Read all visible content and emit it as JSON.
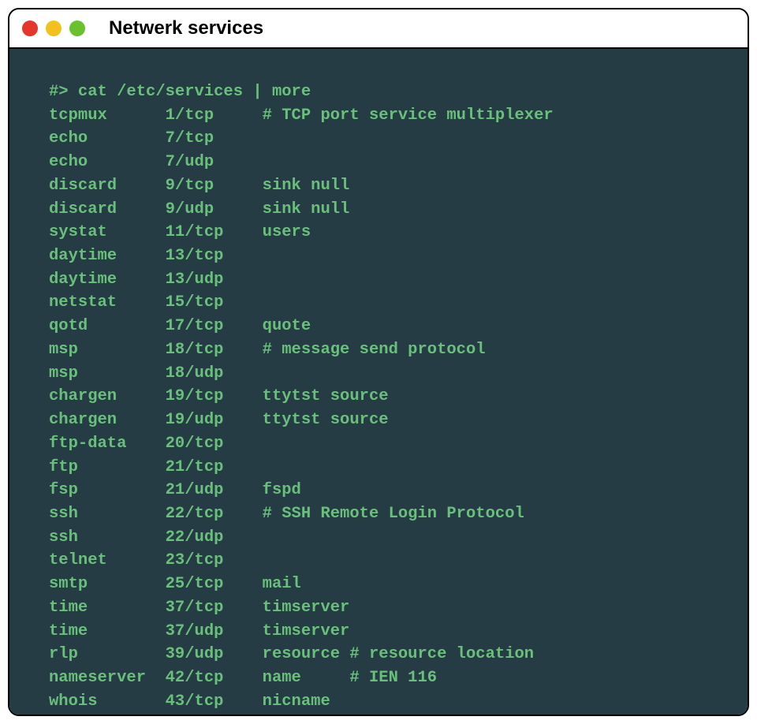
{
  "window": {
    "title": "Netwerk services"
  },
  "terminal": {
    "prompt": "#> cat /etc/services | more",
    "rows": [
      {
        "name": "tcpmux",
        "port": "1/tcp",
        "alias": "",
        "comment": "# TCP port service multiplexer"
      },
      {
        "name": "echo",
        "port": "7/tcp",
        "alias": "",
        "comment": ""
      },
      {
        "name": "echo",
        "port": "7/udp",
        "alias": "",
        "comment": ""
      },
      {
        "name": "discard",
        "port": "9/tcp",
        "alias": "sink null",
        "comment": ""
      },
      {
        "name": "discard",
        "port": "9/udp",
        "alias": "sink null",
        "comment": ""
      },
      {
        "name": "systat",
        "port": "11/tcp",
        "alias": "users",
        "comment": ""
      },
      {
        "name": "daytime",
        "port": "13/tcp",
        "alias": "",
        "comment": ""
      },
      {
        "name": "daytime",
        "port": "13/udp",
        "alias": "",
        "comment": ""
      },
      {
        "name": "netstat",
        "port": "15/tcp",
        "alias": "",
        "comment": ""
      },
      {
        "name": "qotd",
        "port": "17/tcp",
        "alias": "quote",
        "comment": ""
      },
      {
        "name": "msp",
        "port": "18/tcp",
        "alias": "",
        "comment": "# message send protocol"
      },
      {
        "name": "msp",
        "port": "18/udp",
        "alias": "",
        "comment": ""
      },
      {
        "name": "chargen",
        "port": "19/tcp",
        "alias": "ttytst source",
        "comment": ""
      },
      {
        "name": "chargen",
        "port": "19/udp",
        "alias": "ttytst source",
        "comment": ""
      },
      {
        "name": "ftp-data",
        "port": "20/tcp",
        "alias": "",
        "comment": ""
      },
      {
        "name": "ftp",
        "port": "21/tcp",
        "alias": "",
        "comment": ""
      },
      {
        "name": "fsp",
        "port": "21/udp",
        "alias": "fspd",
        "comment": ""
      },
      {
        "name": "ssh",
        "port": "22/tcp",
        "alias": "",
        "comment": "# SSH Remote Login Protocol"
      },
      {
        "name": "ssh",
        "port": "22/udp",
        "alias": "",
        "comment": ""
      },
      {
        "name": "telnet",
        "port": "23/tcp",
        "alias": "",
        "comment": ""
      },
      {
        "name": "smtp",
        "port": "25/tcp",
        "alias": "mail",
        "comment": ""
      },
      {
        "name": "time",
        "port": "37/tcp",
        "alias": "timserver",
        "comment": ""
      },
      {
        "name": "time",
        "port": "37/udp",
        "alias": "timserver",
        "comment": ""
      },
      {
        "name": "rlp",
        "port": "39/udp",
        "alias": "resource",
        "comment": "# resource location"
      },
      {
        "name": "nameserver",
        "port": "42/tcp",
        "alias": "name",
        "comment": "# IEN 116"
      },
      {
        "name": "whois",
        "port": "43/tcp",
        "alias": "nicname",
        "comment": ""
      }
    ]
  },
  "colors": {
    "terminal_bg": "#253c44",
    "terminal_fg": "#69c07b",
    "red": "#e6352b",
    "yellow": "#f3c11b",
    "green": "#68c12d"
  }
}
